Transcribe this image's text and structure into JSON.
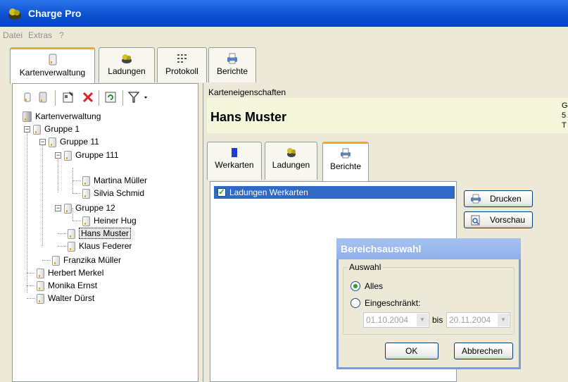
{
  "window": {
    "title": "Charge Pro"
  },
  "menu": {
    "items": [
      "Datei",
      "Extras",
      "?"
    ]
  },
  "main_tabs": [
    {
      "label": "Kartenverwaltung",
      "active": true
    },
    {
      "label": "Ladungen",
      "active": false
    },
    {
      "label": "Protokoll",
      "active": false
    },
    {
      "label": "Berichte",
      "active": false
    }
  ],
  "tree": {
    "root": "Kartenverwaltung",
    "gruppe1": "Gruppe 1",
    "gruppe11": "Gruppe 11",
    "gruppe111": "Gruppe 111",
    "martina": "Martina Müller",
    "silvia": "Silvia Schmid",
    "gruppe12": "Gruppe 12",
    "heiner": "Heiner Hug",
    "hans": "Hans Muster",
    "klaus": "Klaus Federer",
    "franzika": "Franzika Müller",
    "herbert": "Herbert Merkel",
    "monika": "Monika Ernst",
    "walter": "Walter Dürst"
  },
  "properties": {
    "caption": "Karteneigenschaften",
    "name": "Hans Muster",
    "edge_text": [
      "G",
      "5",
      "T"
    ]
  },
  "sub_tabs": [
    {
      "label": "Werkarten",
      "active": false
    },
    {
      "label": "Ladungen",
      "active": false
    },
    {
      "label": "Berichte",
      "active": true
    }
  ],
  "reports": {
    "items": [
      {
        "label": "Ladungen Werkarten",
        "checked": true
      }
    ]
  },
  "buttons": {
    "print": "Drucken",
    "preview": "Vorschau"
  },
  "dialog": {
    "title": "Bereichsauswahl",
    "group": "Auswahl",
    "option_all": "Alles",
    "option_limited": "Eingeschränkt:",
    "selected": "Alles",
    "date_from": "01.10.2004",
    "between": "bis",
    "date_to": "20.11.2004",
    "ok": "OK",
    "cancel": "Abbrechen"
  },
  "colors": {
    "titlebar": "#0a4fd0",
    "accent_tab": "#f5a623",
    "selection": "#316ac5",
    "dialog_title": "#8fb0ea"
  }
}
